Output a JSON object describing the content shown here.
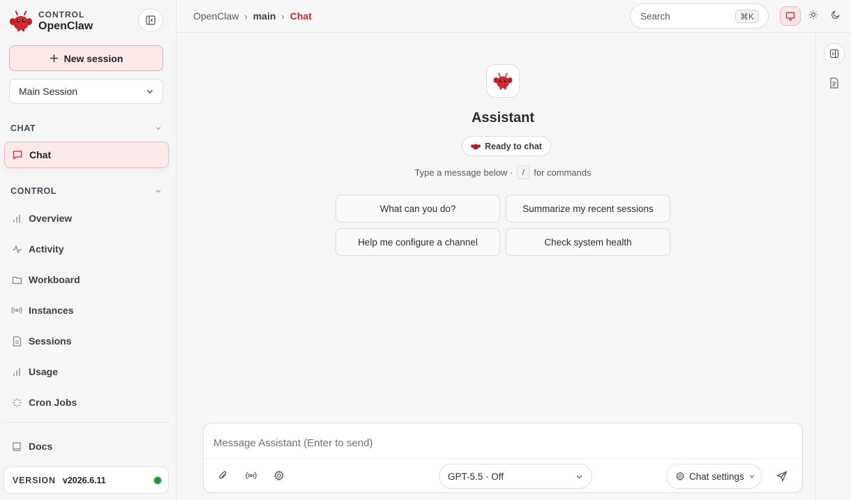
{
  "brand": {
    "small": "CONTROL",
    "name": "OpenClaw"
  },
  "sidebar": {
    "new_session_label": "New session",
    "session_select": "Main Session",
    "sections": [
      {
        "label": "CHAT"
      },
      {
        "label": "CONTROL"
      }
    ],
    "chat_items": [
      {
        "label": "Chat",
        "icon": "message-icon",
        "active": true
      }
    ],
    "control_items": [
      {
        "label": "Overview",
        "icon": "bar-chart-icon"
      },
      {
        "label": "Activity",
        "icon": "activity-icon"
      },
      {
        "label": "Workboard",
        "icon": "folder-icon"
      },
      {
        "label": "Instances",
        "icon": "radio-icon"
      },
      {
        "label": "Sessions",
        "icon": "document-icon"
      },
      {
        "label": "Usage",
        "icon": "bar-chart-icon"
      },
      {
        "label": "Cron Jobs",
        "icon": "loader-icon"
      }
    ],
    "docs_label": "Docs",
    "version": {
      "label": "VERSION",
      "value": "v2026.6.11",
      "status_color": "#1f8f3a"
    }
  },
  "topbar": {
    "breadcrumb": [
      "OpenClaw",
      "main",
      "Chat"
    ],
    "search_placeholder": "Search",
    "search_shortcut": "⌘K",
    "theme_active": "system"
  },
  "main": {
    "assistant_name": "Assistant",
    "status_badge": "Ready to chat",
    "hint_before": "Type a message below ·",
    "hint_key": "/",
    "hint_after": "for commands",
    "suggestions": [
      "What can you do?",
      "Summarize my recent sessions",
      "Help me configure a channel",
      "Check system health"
    ],
    "composer": {
      "placeholder": "Message Assistant (Enter to send)",
      "model": "GPT-5.5 · Off",
      "settings_label": "Chat settings"
    }
  },
  "colors": {
    "accent": "#c9242b",
    "accent_bg": "#fde8e8",
    "status_ok": "#1f8f3a"
  }
}
